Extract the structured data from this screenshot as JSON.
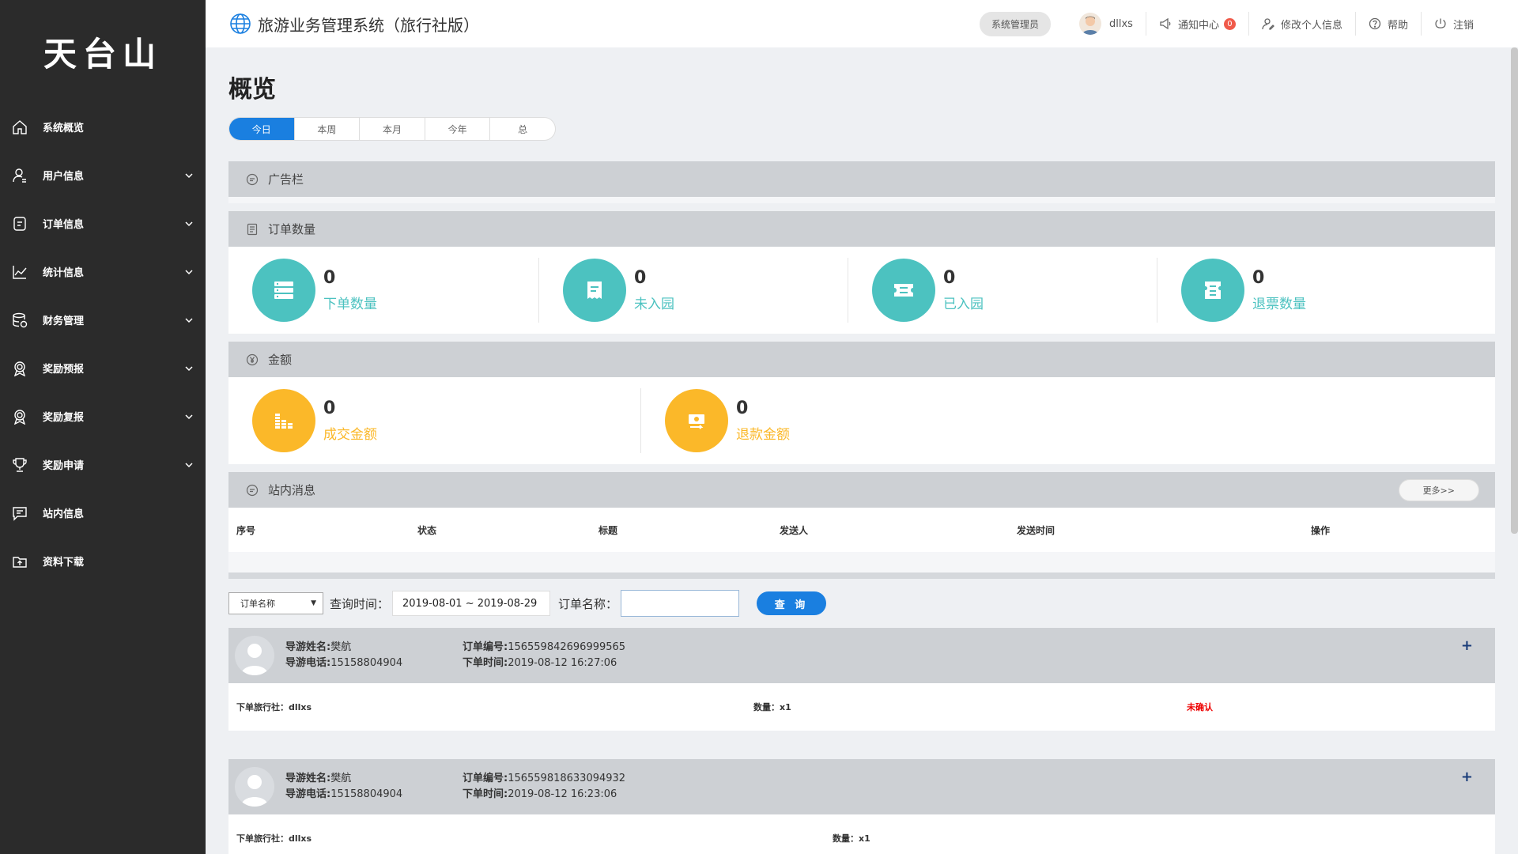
{
  "sidebar": {
    "logo": "天台山",
    "items": [
      {
        "label": "系统概览",
        "icon": "home-icon",
        "expandable": false
      },
      {
        "label": "用户信息",
        "icon": "user-icon",
        "expandable": true
      },
      {
        "label": "订单信息",
        "icon": "order-icon",
        "expandable": true
      },
      {
        "label": "统计信息",
        "icon": "chart-icon",
        "expandable": true
      },
      {
        "label": "财务管理",
        "icon": "database-icon",
        "expandable": true
      },
      {
        "label": "奖励预报",
        "icon": "award-icon",
        "expandable": true
      },
      {
        "label": "奖励复报",
        "icon": "award-icon",
        "expandable": true
      },
      {
        "label": "奖励申请",
        "icon": "trophy-icon",
        "expandable": true
      },
      {
        "label": "站内信息",
        "icon": "message-icon",
        "expandable": false
      },
      {
        "label": "资料下载",
        "icon": "download-icon",
        "expandable": false
      }
    ]
  },
  "header": {
    "title": "旅游业务管理系统（旅行社版）",
    "role": "系统管理员",
    "username": "dllxs",
    "notify_label": "通知中心",
    "notify_count": "0",
    "profile_label": "修改个人信息",
    "help_label": "帮助",
    "logout_label": "注销"
  },
  "page": {
    "title": "概览",
    "tabs": [
      "今日",
      "本周",
      "本月",
      "今年",
      "总"
    ]
  },
  "ads": {
    "title": "广告栏"
  },
  "orders_count": {
    "title": "订单数量",
    "stats": [
      {
        "value": "0",
        "label": "下单数量"
      },
      {
        "value": "0",
        "label": "未入园"
      },
      {
        "value": "0",
        "label": "已入园"
      },
      {
        "value": "0",
        "label": "退票数量"
      }
    ]
  },
  "amount": {
    "title": "金额",
    "stats": [
      {
        "value": "0",
        "label": "成交金额"
      },
      {
        "value": "0",
        "label": "退款金额"
      }
    ]
  },
  "messages": {
    "title": "站内消息",
    "more": "更多>>",
    "columns": [
      "序号",
      "状态",
      "标题",
      "发送人",
      "发送时间",
      "操作"
    ]
  },
  "query": {
    "select_value": "订单名称",
    "time_label": "查询时间：",
    "date_range": "2019-08-01 ~ 2019-08-29",
    "name_label": "订单名称：",
    "name_value": "",
    "button": "查 询"
  },
  "orders": [
    {
      "guide_name_label": "导游姓名:",
      "guide_name": "樊航",
      "guide_phone_label": "导游电话:",
      "guide_phone": "15158804904",
      "order_no_label": "订单编号:",
      "order_no": "156559842696999565",
      "order_time_label": "下单时间:",
      "order_time": "2019-08-12 16:27:06",
      "agency": "下单旅行社：dllxs",
      "qty": "数量：x1",
      "status": "未确认"
    },
    {
      "guide_name_label": "导游姓名:",
      "guide_name": "樊航",
      "guide_phone_label": "导游电话:",
      "guide_phone": "15158804904",
      "order_no_label": "订单编号:",
      "order_no": "156559818633094932",
      "order_time_label": "下单时间:",
      "order_time": "2019-08-12 16:23:06",
      "agency": "下单旅行社：dllxs",
      "qty": "数量：x1",
      "status": ""
    }
  ],
  "colors": {
    "accent": "#1a7fe0",
    "teal": "#4cc2c0",
    "amber": "#fbb829",
    "sidebar": "#2b2b2b"
  }
}
